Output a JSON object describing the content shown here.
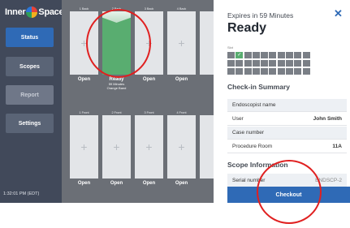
{
  "app": {
    "logo_text_left": "Inner",
    "logo_text_right": "Space"
  },
  "sidebar": {
    "items": [
      {
        "label": "Status",
        "state": "active"
      },
      {
        "label": "Scopes",
        "state": "inactive"
      },
      {
        "label": "Report",
        "state": "disabled"
      },
      {
        "label": "Settings",
        "state": "inactive"
      }
    ],
    "time": "1:32:01 PM (EDT)"
  },
  "cabinets": {
    "back": [
      {
        "header": "1 Back",
        "status": "Open"
      },
      {
        "header": "2 Back",
        "status": "Ready",
        "sub1": "59 Minutes",
        "sub2": "Orange Band"
      },
      {
        "header": "3 Back",
        "status": "Open"
      },
      {
        "header": "4 Back",
        "status": "Open"
      }
    ],
    "front": [
      {
        "header": "1 Front",
        "status": "Open"
      },
      {
        "header": "2 Front",
        "status": "Open"
      },
      {
        "header": "3 Front",
        "status": "Open"
      },
      {
        "header": "4 Front",
        "status": "Open"
      }
    ]
  },
  "panel": {
    "expires": "Expires in 59 Minutes",
    "title": "Ready",
    "close": "✕",
    "slot_label": "Slot",
    "summary_title": "Check-in Summary",
    "rows": [
      {
        "label": "Endoscopist name",
        "value": ""
      },
      {
        "label": "User",
        "value": "John Smith"
      },
      {
        "label": "Case number",
        "value": ""
      },
      {
        "label": "Procedure Room",
        "value": "11A"
      }
    ],
    "scope_title": "Scope Information",
    "serial_label": "Serial number",
    "serial_value": "ENDSCP-2",
    "checkout": "Checkout"
  },
  "colors": {
    "accent": "#2f6ab6",
    "ready": "#59ad70",
    "annotation": "#e02020"
  }
}
